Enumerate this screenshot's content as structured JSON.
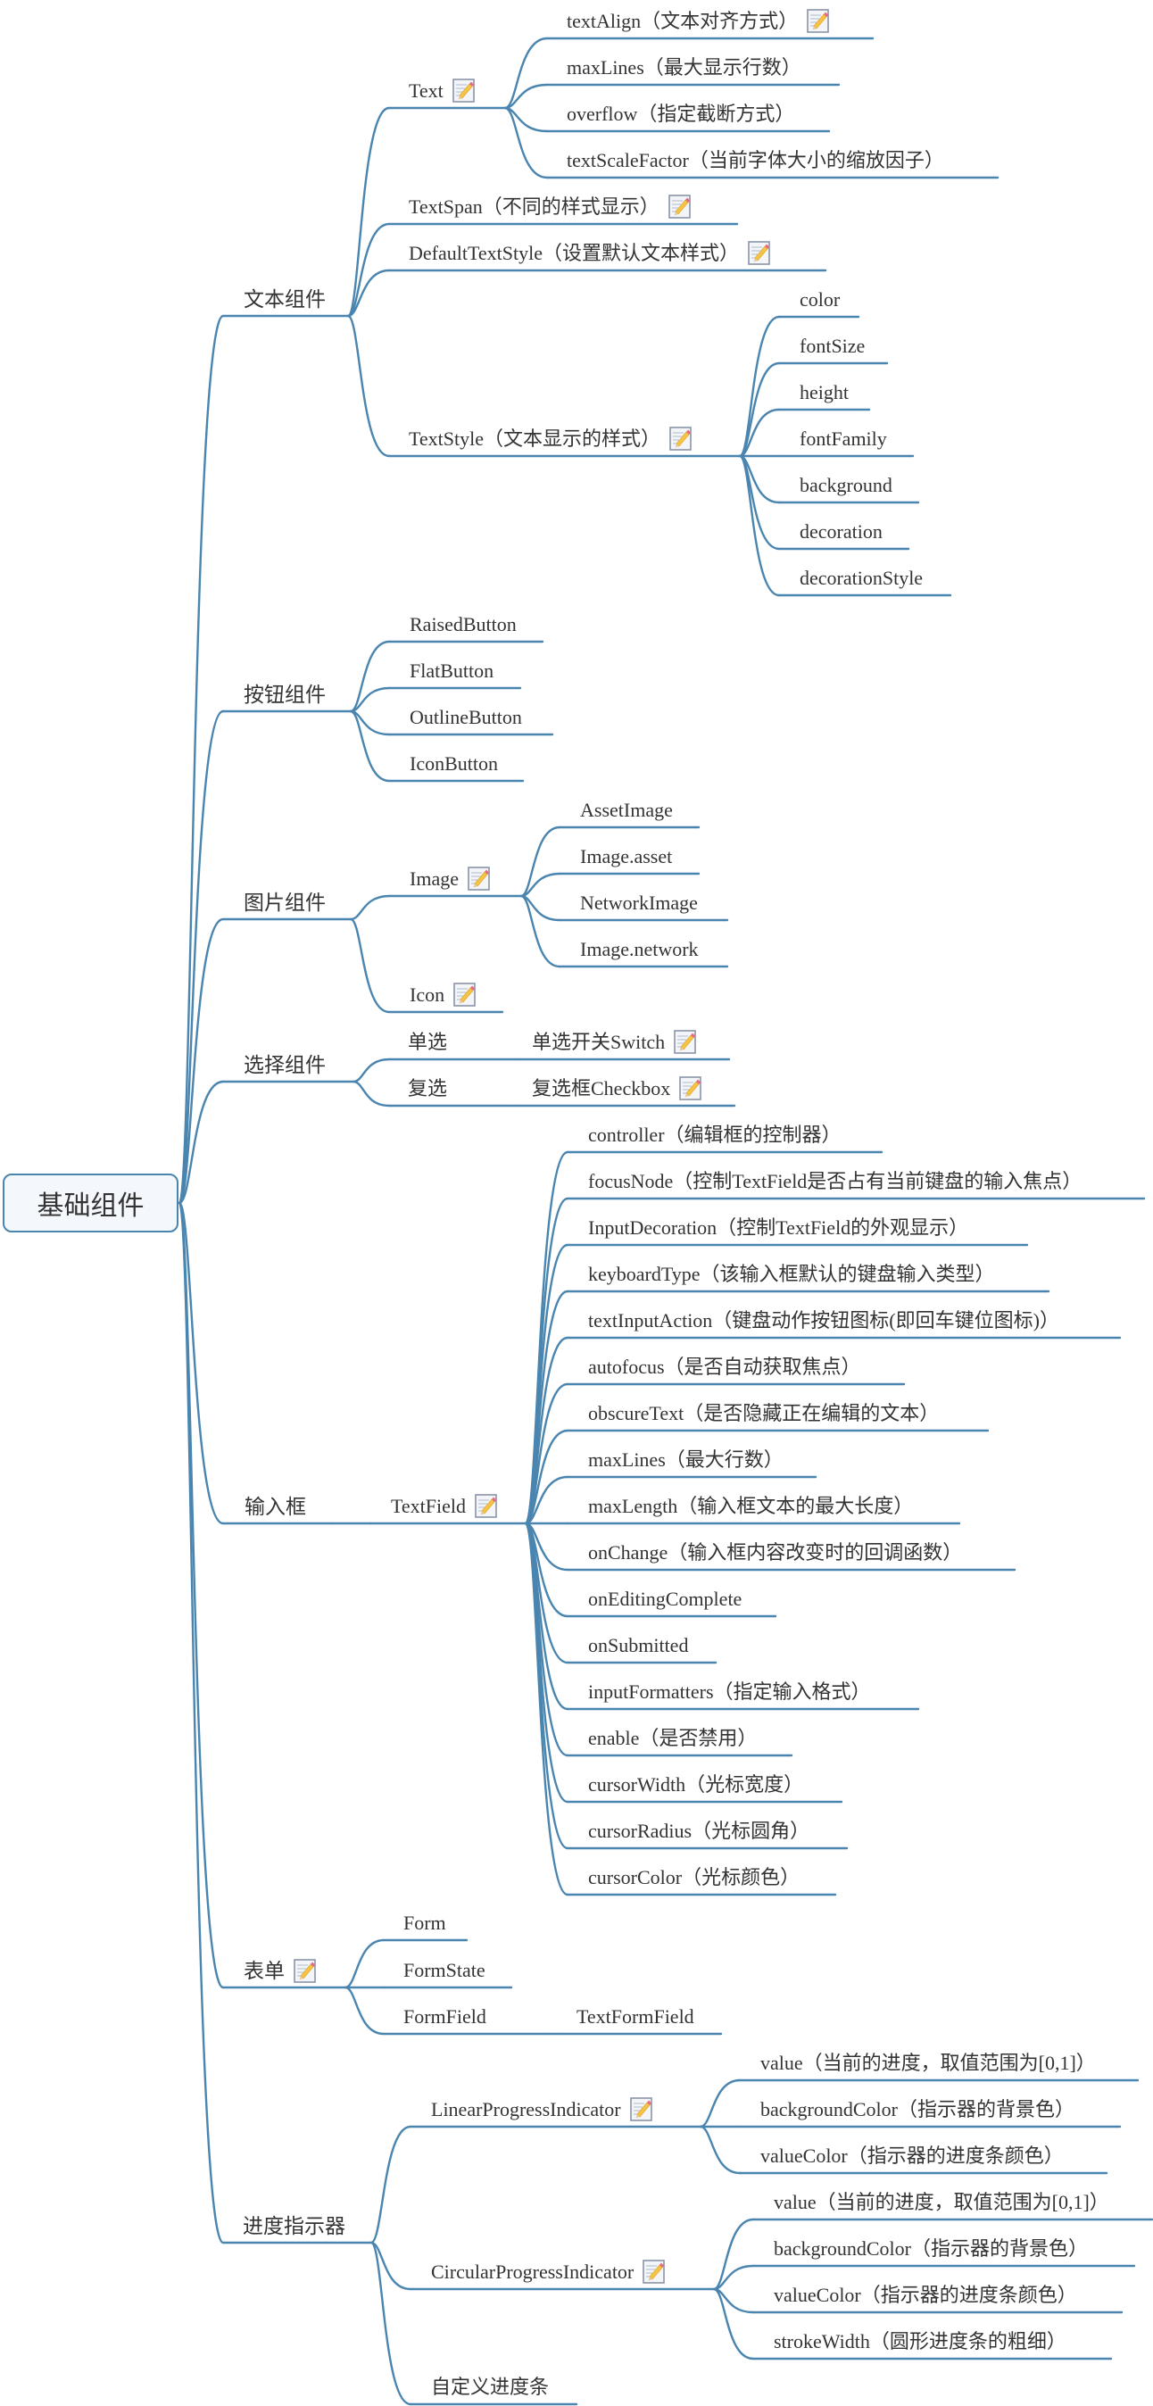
{
  "map": {
    "root": {
      "label": "基础组件",
      "children": [
        {
          "label": "文本组件",
          "children": [
            {
              "label": "Text",
              "icon": "note-icon",
              "children": [
                {
                  "label": "textAlign（文本对齐方式）",
                  "icon": "note-icon"
                },
                {
                  "label": "maxLines（最大显示行数）"
                },
                {
                  "label": "overflow（指定截断方式）"
                },
                {
                  "label": "textScaleFactor（当前字体大小的缩放因子）"
                }
              ]
            },
            {
              "label": "TextSpan（不同的样式显示）",
              "icon": "note-icon"
            },
            {
              "label": "DefaultTextStyle（设置默认文本样式）",
              "icon": "note-icon"
            },
            {
              "label": "TextStyle（文本显示的样式）",
              "icon": "note-icon",
              "children": [
                {
                  "label": "color"
                },
                {
                  "label": "fontSize"
                },
                {
                  "label": "height"
                },
                {
                  "label": "fontFamily"
                },
                {
                  "label": "background"
                },
                {
                  "label": "decoration"
                },
                {
                  "label": "decorationStyle"
                }
              ]
            }
          ]
        },
        {
          "label": "按钮组件",
          "children": [
            {
              "label": "RaisedButton"
            },
            {
              "label": "FlatButton"
            },
            {
              "label": "OutlineButton"
            },
            {
              "label": "IconButton"
            }
          ]
        },
        {
          "label": "图片组件",
          "children": [
            {
              "label": "Image",
              "icon": "note-icon",
              "children": [
                {
                  "label": "AssetImage"
                },
                {
                  "label": "Image.asset"
                },
                {
                  "label": "NetworkImage"
                },
                {
                  "label": "Image.network"
                }
              ]
            },
            {
              "label": "Icon",
              "icon": "note-icon"
            }
          ]
        },
        {
          "label": "选择组件",
          "children": [
            {
              "label": "单选",
              "children": [
                {
                  "label": "单选开关Switch",
                  "icon": "note-icon"
                }
              ]
            },
            {
              "label": "复选",
              "children": [
                {
                  "label": "复选框Checkbox",
                  "icon": "note-icon"
                }
              ]
            }
          ]
        },
        {
          "label": "输入框",
          "children": [
            {
              "label": "TextField",
              "icon": "note-icon",
              "children": [
                {
                  "label": "controller（编辑框的控制器）"
                },
                {
                  "label": "focusNode（控制TextField是否占有当前键盘的输入焦点）"
                },
                {
                  "label": "InputDecoration（控制TextField的外观显示）"
                },
                {
                  "label": "keyboardType（该输入框默认的键盘输入类型）"
                },
                {
                  "label": "textInputAction（键盘动作按钮图标(即回车键位图标)）"
                },
                {
                  "label": "autofocus（是否自动获取焦点）"
                },
                {
                  "label": "obscureText（是否隐藏正在编辑的文本）"
                },
                {
                  "label": "maxLines（最大行数）"
                },
                {
                  "label": "maxLength（输入框文本的最大长度）"
                },
                {
                  "label": "onChange（输入框内容改变时的回调函数）"
                },
                {
                  "label": "onEditingComplete"
                },
                {
                  "label": "onSubmitted"
                },
                {
                  "label": "inputFormatters（指定输入格式）"
                },
                {
                  "label": "enable（是否禁用）"
                },
                {
                  "label": "cursorWidth（光标宽度）"
                },
                {
                  "label": "cursorRadius（光标圆角）"
                },
                {
                  "label": "cursorColor（光标颜色）"
                }
              ]
            }
          ]
        },
        {
          "label": "表单",
          "icon": "note-icon",
          "children": [
            {
              "label": "Form"
            },
            {
              "label": "FormState"
            },
            {
              "label": "FormField",
              "children": [
                {
                  "label": "TextFormField"
                }
              ]
            }
          ]
        },
        {
          "label": "进度指示器",
          "children": [
            {
              "label": "LinearProgressIndicator",
              "icon": "note-icon",
              "children": [
                {
                  "label": "value（当前的进度，取值范围为[0,1]）"
                },
                {
                  "label": "backgroundColor（指示器的背景色）"
                },
                {
                  "label": "valueColor（指示器的进度条颜色）"
                }
              ]
            },
            {
              "label": "CircularProgressIndicator",
              "icon": "note-icon",
              "children": [
                {
                  "label": "value（当前的进度，取值范围为[0,1]）"
                },
                {
                  "label": "backgroundColor（指示器的背景色）"
                },
                {
                  "label": "valueColor（指示器的进度条颜色）"
                },
                {
                  "label": "strokeWidth（圆形进度条的粗细）"
                }
              ]
            },
            {
              "label": "自定义进度条"
            }
          ]
        }
      ]
    }
  },
  "colors": {
    "branch_line": "#4a85b0",
    "root_border": "#4a85b0",
    "root_fill": "#f4f8fc",
    "text": "#333333"
  }
}
